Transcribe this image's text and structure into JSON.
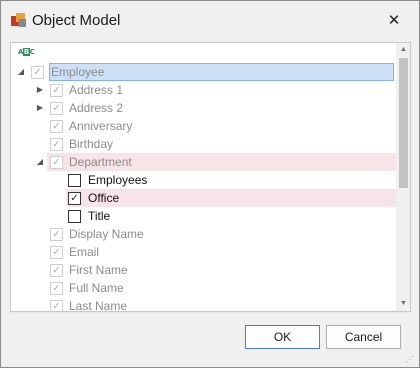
{
  "window": {
    "title": "Object Model",
    "close_glyph": "✕"
  },
  "tree": {
    "header_icon": {
      "a": "A",
      "b": "B",
      "c": "C"
    },
    "rows": [
      {
        "label": "Employee",
        "checked": true,
        "expander": "collapse",
        "level": 0,
        "style": "dim",
        "highlight": "blue"
      },
      {
        "label": "Address 1",
        "checked": true,
        "expander": "expand",
        "level": 1,
        "style": "dim",
        "highlight": "none"
      },
      {
        "label": "Address 2",
        "checked": true,
        "expander": "expand",
        "level": 1,
        "style": "dim",
        "highlight": "none"
      },
      {
        "label": "Anniversary",
        "checked": true,
        "expander": "none",
        "level": 1,
        "style": "dim",
        "highlight": "none"
      },
      {
        "label": "Birthday",
        "checked": true,
        "expander": "none",
        "level": 1,
        "style": "dim",
        "highlight": "none"
      },
      {
        "label": "Department",
        "checked": true,
        "expander": "collapse",
        "level": 1,
        "style": "dim",
        "highlight": "pink"
      },
      {
        "label": "Employees",
        "checked": false,
        "expander": "none",
        "level": 2,
        "style": "dark",
        "highlight": "none"
      },
      {
        "label": "Office",
        "checked": true,
        "expander": "none",
        "level": 2,
        "style": "dark",
        "highlight": "pink"
      },
      {
        "label": "Title",
        "checked": false,
        "expander": "none",
        "level": 2,
        "style": "dark",
        "highlight": "none"
      },
      {
        "label": "Display Name",
        "checked": true,
        "expander": "none",
        "level": 1,
        "style": "dim",
        "highlight": "none"
      },
      {
        "label": "Email",
        "checked": true,
        "expander": "none",
        "level": 1,
        "style": "dim",
        "highlight": "none"
      },
      {
        "label": "First Name",
        "checked": true,
        "expander": "none",
        "level": 1,
        "style": "dim",
        "highlight": "none"
      },
      {
        "label": "Full Name",
        "checked": true,
        "expander": "none",
        "level": 1,
        "style": "dim",
        "highlight": "none"
      },
      {
        "label": "Last Name",
        "checked": true,
        "expander": "none",
        "level": 1,
        "style": "dim",
        "highlight": "none"
      }
    ]
  },
  "buttons": {
    "ok": "OK",
    "cancel": "Cancel"
  },
  "colors": {
    "highlight_blue_bg": "#cde0f5",
    "highlight_blue_border": "#7eb4ea",
    "highlight_pink_bg": "#f8e3e6",
    "accent_border": "#4a7fc7"
  },
  "icons": {
    "expand": "▶",
    "collapse": "◢",
    "check": "✓"
  }
}
